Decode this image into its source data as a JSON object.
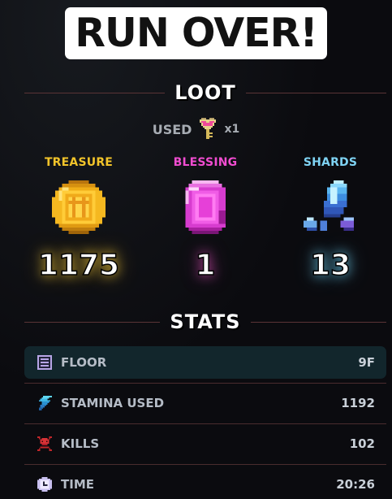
{
  "title": "RUN OVER!",
  "loot": {
    "header": "LOOT",
    "used": {
      "label": "USED",
      "item_icon": "heart-key-icon",
      "count": "x1"
    },
    "items": [
      {
        "label": "TREASURE",
        "icon": "gold-coin-icon",
        "value": "1175",
        "color": "#f2c42a"
      },
      {
        "label": "BLESSING",
        "icon": "pink-gem-icon",
        "value": "1",
        "color": "#f04cd0"
      },
      {
        "label": "SHARDS",
        "icon": "blue-crystal-shards-icon",
        "value": "13",
        "color": "#7fd3f3"
      }
    ]
  },
  "stats": {
    "header": "STATS",
    "rows": [
      {
        "icon": "floor-icon",
        "label": "FLOOR",
        "value": "9F"
      },
      {
        "icon": "lightning-icon",
        "label": "STAMINA USED",
        "value": "1192"
      },
      {
        "icon": "skull-crossbones-icon",
        "label": "KILLS",
        "value": "102"
      },
      {
        "icon": "clock-icon",
        "label": "TIME",
        "value": "20:26"
      }
    ]
  }
}
